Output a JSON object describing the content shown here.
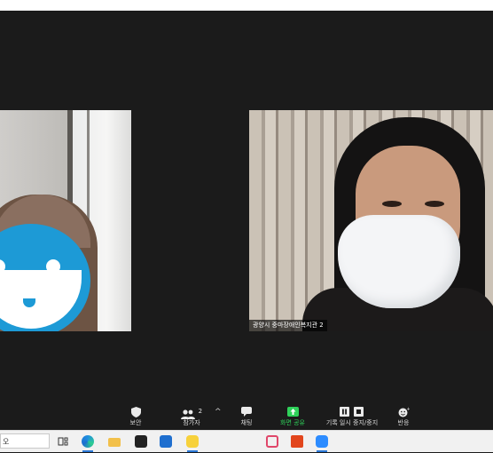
{
  "participants": [
    {
      "name": ""
    },
    {
      "name": "광양시 중마장애인복지관 2"
    }
  ],
  "controls": {
    "security": {
      "label": "보안",
      "icon": "shield-icon"
    },
    "participants": {
      "label": "참가자",
      "count": "2",
      "icon": "people-icon"
    },
    "chat": {
      "label": "채팅",
      "icon": "chat-icon"
    },
    "share_screen": {
      "label": "화면 공유",
      "icon": "share-screen-icon"
    },
    "record": {
      "label": "기록 일시 중지/중지",
      "icon": "pause-stop-icon"
    },
    "reactions": {
      "label": "반응",
      "icon": "reaction-icon"
    }
  },
  "taskbar": {
    "search_text": "오",
    "colors": {
      "accent": "#2b78d6",
      "share_green": "#2fd15a",
      "smiley_blue": "#1d9ad6"
    }
  }
}
